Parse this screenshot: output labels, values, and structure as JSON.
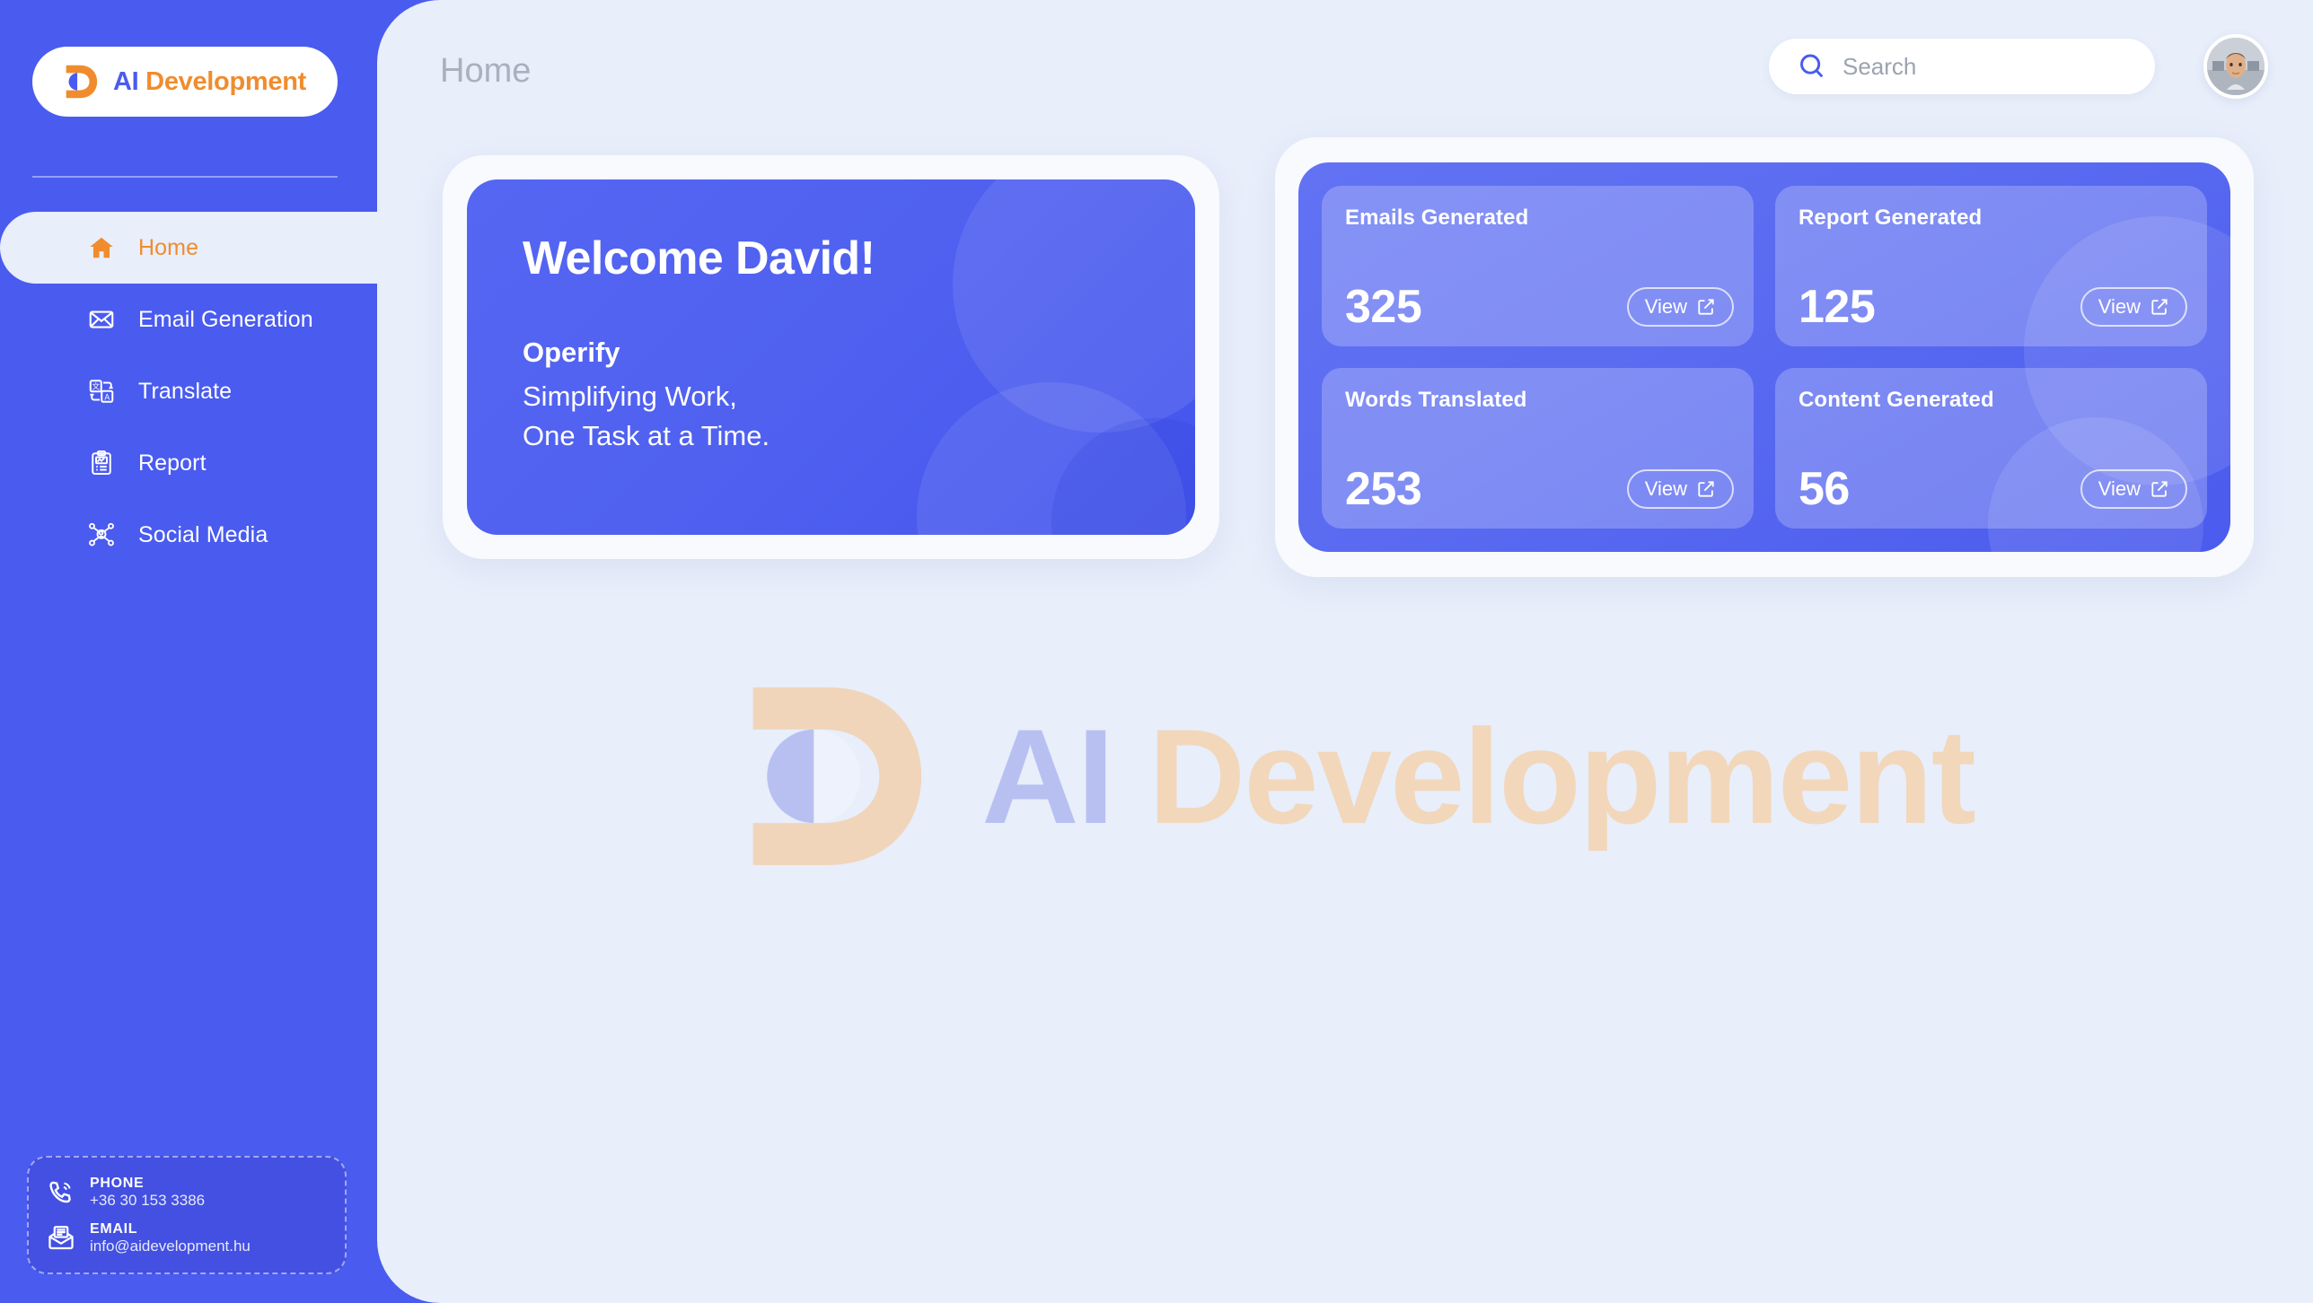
{
  "brand": {
    "name_ai": "AI",
    "name_dev": "Development",
    "mark_icon": "brand-d-mark-icon",
    "accent_blue": "#4A5BF0",
    "accent_orange": "#F08C2E"
  },
  "sidebar": {
    "divider": true,
    "items": [
      {
        "label": "Home",
        "icon": "home-icon",
        "active": true
      },
      {
        "label": "Email Generation",
        "icon": "envelope-icon",
        "active": false
      },
      {
        "label": "Translate",
        "icon": "translate-icon",
        "active": false
      },
      {
        "label": "Report",
        "icon": "clipboard-chart-icon",
        "active": false
      },
      {
        "label": "Social Media",
        "icon": "share-network-icon",
        "active": false
      }
    ],
    "contact": {
      "phone_label": "PHONE",
      "phone_value": "+36 30 153 3386",
      "phone_icon": "phone-ring-icon",
      "email_label": "EMAIL",
      "email_value": "info@aidevelopment.hu",
      "email_icon": "open-envelope-icon"
    }
  },
  "header": {
    "title": "Home",
    "search": {
      "placeholder": "Search",
      "value": "",
      "icon": "search-icon"
    },
    "avatar_icon": "user-avatar-photo"
  },
  "welcome": {
    "title": "Welcome David!",
    "brand_line": "Operify",
    "lines": [
      "Simplifying Work,",
      "One Task at a Time."
    ]
  },
  "stats": {
    "view_label": "View",
    "view_icon": "external-link-icon",
    "cards": [
      {
        "title": "Emails Generated",
        "value": "325"
      },
      {
        "title": "Report Generated",
        "value": "125"
      },
      {
        "title": "Words Translated",
        "value": "253"
      },
      {
        "title": "Content Generated",
        "value": "56"
      }
    ]
  },
  "watermark": {
    "mark_icon": "brand-d-mark-watermark-icon",
    "text_ai": "AI",
    "text_dev": "Development"
  }
}
